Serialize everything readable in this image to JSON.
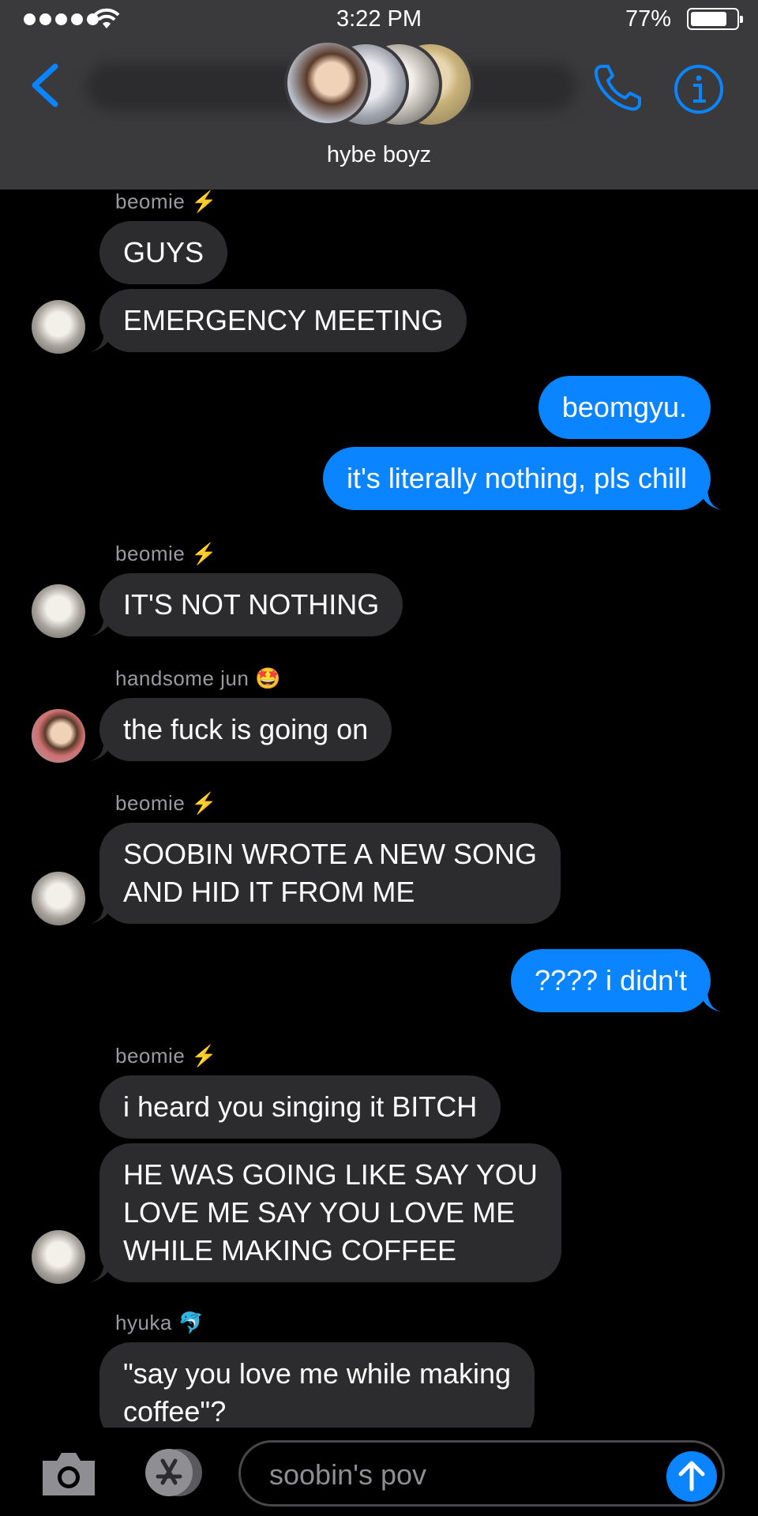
{
  "status_bar": {
    "time": "3:22 PM",
    "battery": "77%",
    "battery_level": 0.77
  },
  "header": {
    "group_name": "hybe boyz"
  },
  "messages": [
    {
      "sender": "beomie",
      "sender_emoji": "⚡"
    },
    {
      "text": "GUYS"
    },
    {
      "text": "EMERGENCY MEETING"
    },
    {
      "text": "beomgyu."
    },
    {
      "text": "it's literally nothing, pls chill"
    },
    {
      "sender": "beomie",
      "sender_emoji": "⚡"
    },
    {
      "text": "IT'S NOT NOTHING"
    },
    {
      "sender": "handsome jun",
      "sender_emoji": "🤩"
    },
    {
      "text": "the fuck is going on"
    },
    {
      "sender": "beomie",
      "sender_emoji": "⚡"
    },
    {
      "text": "SOOBIN WROTE A NEW SONG\nAND HID IT FROM ME"
    },
    {
      "text": "???? i didn't"
    },
    {
      "sender": "beomie",
      "sender_emoji": "⚡"
    },
    {
      "text": "i heard you singing it BITCH"
    },
    {
      "text": "HE WAS GOING LIKE SAY YOU\nLOVE ME SAY YOU LOVE ME\nWHILE MAKING COFFEE"
    },
    {
      "sender": "hyuka",
      "sender_emoji": "🐬"
    },
    {
      "text": "\"say you love me while making\ncoffee\"?"
    }
  ],
  "input": {
    "placeholder": "soobin's pov"
  },
  "icons": {
    "back": "chevron-left-icon",
    "call": "phone-icon",
    "info": "info-icon",
    "camera": "camera-icon",
    "apps": "app-store-icon",
    "send": "arrow-up-icon"
  },
  "colors": {
    "accent": "#0a84ff",
    "incoming": "#2c2c2e",
    "header": "#3a3a3c"
  }
}
